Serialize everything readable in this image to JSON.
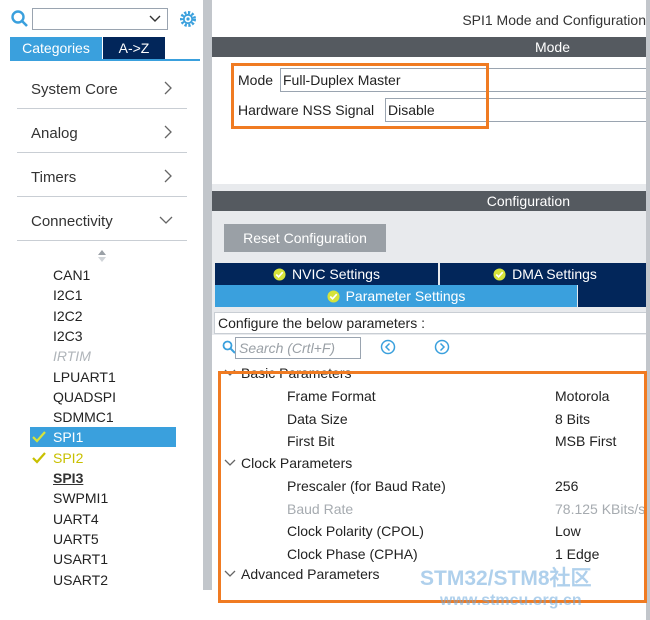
{
  "left": {
    "search_value": "",
    "tabs": [
      {
        "label": "Categories"
      },
      {
        "label": "A->Z"
      }
    ],
    "categories": [
      {
        "label": "System Core"
      },
      {
        "label": "Analog"
      },
      {
        "label": "Timers"
      },
      {
        "label": "Connectivity"
      }
    ],
    "peripherals": [
      {
        "label": "CAN1",
        "state": "normal"
      },
      {
        "label": "I2C1",
        "state": "normal"
      },
      {
        "label": "I2C2",
        "state": "normal"
      },
      {
        "label": "I2C3",
        "state": "normal"
      },
      {
        "label": "IRTIM",
        "state": "disabled"
      },
      {
        "label": "LPUART1",
        "state": "normal"
      },
      {
        "label": "QUADSPI",
        "state": "normal"
      },
      {
        "label": "SDMMC1",
        "state": "normal"
      },
      {
        "label": "SPI1",
        "state": "selected"
      },
      {
        "label": "SPI2",
        "state": "warn"
      },
      {
        "label": "SPI3",
        "state": "bold"
      },
      {
        "label": "SWPMI1",
        "state": "normal"
      },
      {
        "label": "UART4",
        "state": "normal"
      },
      {
        "label": "UART5",
        "state": "normal"
      },
      {
        "label": "USART1",
        "state": "normal"
      },
      {
        "label": "USART2",
        "state": "normal"
      }
    ]
  },
  "right": {
    "title": "SPI1 Mode and Configuration",
    "mode_header": "Mode",
    "mode": {
      "mode_label": "Mode",
      "mode_value": "Full-Duplex Master",
      "nss_label": "Hardware NSS Signal",
      "nss_value": "Disable"
    },
    "config_header": "Configuration",
    "reset_button": "Reset Configuration",
    "settings_tabs": {
      "nvic": "NVIC Settings",
      "dma": "DMA Settings",
      "params": "Parameter Settings"
    },
    "hint": "Configure the below parameters :",
    "search_placeholder": "Search (Crtl+F)",
    "groups": [
      {
        "label": "Basic Parameters",
        "rows": [
          {
            "name": "Frame Format",
            "value": "Motorola"
          },
          {
            "name": "Data Size",
            "value": "8 Bits"
          },
          {
            "name": "First Bit",
            "value": "MSB First"
          }
        ]
      },
      {
        "label": "Clock Parameters",
        "rows": [
          {
            "name": "Prescaler (for Baud Rate)",
            "value": "256"
          },
          {
            "name": "Baud Rate",
            "value": "78.125 KBits/s"
          },
          {
            "name": "Clock Polarity (CPOL)",
            "value": "Low"
          },
          {
            "name": "Clock Phase (CPHA)",
            "value": "1 Edge"
          }
        ]
      },
      {
        "label": "Advanced Parameters"
      }
    ]
  },
  "watermark": {
    "line1": "STM32/STM8社区",
    "line2": "www.stmcu.org.cn"
  },
  "colors": {
    "accent": "#3aa0dd",
    "navy": "#02265a",
    "section": "#555a60",
    "highlight": "#f07b22"
  }
}
